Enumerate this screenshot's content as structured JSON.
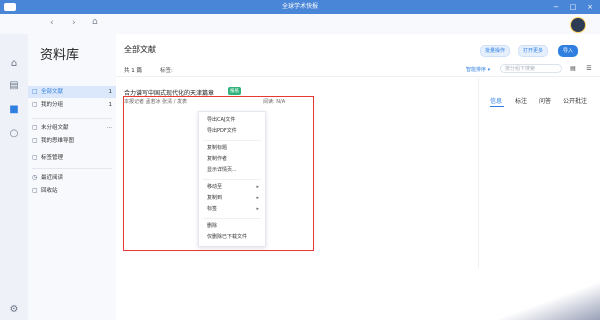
{
  "window": {
    "title": "全球学术快报",
    "ctrl_minimize": "−",
    "ctrl_maximize": "□",
    "ctrl_close": "×"
  },
  "nav": {
    "back_icon": "‹",
    "forward_icon": "›",
    "home_icon": "⌂"
  },
  "rail": [
    "home-icon",
    "book-icon",
    "briefcase-icon",
    "search-icon"
  ],
  "sidebar": {
    "title": "资料库",
    "items": [
      {
        "label": "全部文献",
        "count": "1",
        "active": true,
        "icon": "□"
      },
      {
        "label": "我的分组",
        "count": "1",
        "icon": "▢"
      },
      {
        "label": "未分组文献",
        "count": "···",
        "icon": "▢"
      },
      {
        "label": "我的思维导图",
        "icon": "▢"
      },
      {
        "label": "标签管理",
        "icon": "▢"
      },
      {
        "label": "最近阅读",
        "icon": "◷"
      },
      {
        "label": "回收站",
        "icon": "▢"
      }
    ]
  },
  "main": {
    "title": "全部文献",
    "buttons": {
      "batch": "批量操作",
      "open_more": "打开更多",
      "import": "导入"
    },
    "count_label": "共 1 篇",
    "tag_label": "标签:",
    "sort_label": "智能排序 ▾",
    "search_placeholder": "按分组下搜索",
    "view_grid": "▤",
    "view_list": "☰",
    "tabs": [
      "信息",
      "标注",
      "问答",
      "公开批注"
    ]
  },
  "document": {
    "title": "合力谱写中国式现代化的天津篇章",
    "badge": "报纸",
    "meta": "本报记者 孟若冰 张清 / 发表",
    "pages": "阅读: N/A"
  },
  "context_menu": {
    "items": [
      {
        "label": "导出CAJ文件"
      },
      {
        "label": "导出PDF文件"
      },
      {
        "label": "复制标题"
      },
      {
        "label": "复制作者"
      },
      {
        "label": "显示详情页..."
      },
      {
        "label": "移动至",
        "arrow": "▸"
      },
      {
        "label": "复制到",
        "arrow": "▸"
      },
      {
        "label": "标签",
        "arrow": "▸"
      },
      {
        "label": "删除"
      },
      {
        "label": "仅删除已下载文件"
      }
    ]
  },
  "settings_icon": "⚙"
}
